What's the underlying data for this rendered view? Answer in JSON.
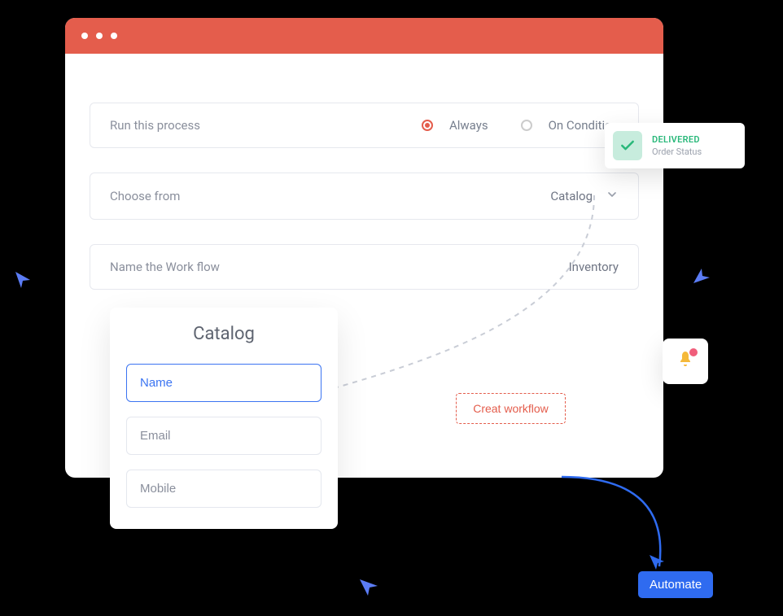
{
  "form": {
    "run_label": "Run this process",
    "opt_always": "Always",
    "opt_condition": "On Condition",
    "choose_label": "Choose from",
    "choose_value": "Catalog",
    "name_label": "Name the Work flow",
    "name_value": "Inventory"
  },
  "catalog": {
    "title": "Catalog",
    "fields": {
      "name": "Name",
      "email": "Email",
      "mobile": "Mobile"
    }
  },
  "create_button": "Creat workflow",
  "delivered": {
    "status": "DELIVERED",
    "sub": "Order Status"
  },
  "automate_button": "Automate"
}
